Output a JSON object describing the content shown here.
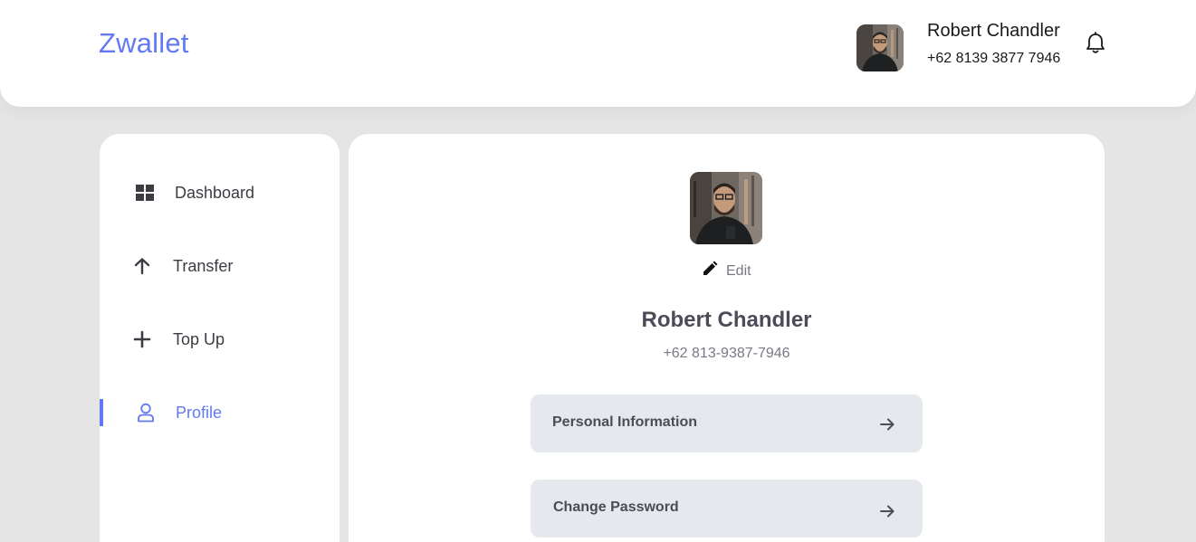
{
  "brand": "Zwallet",
  "user": {
    "name": "Robert Chandler",
    "header_phone": "+62 8139 3877 7946",
    "profile_phone": "+62 813-9387-7946"
  },
  "icons": {
    "bell": "bell-icon",
    "dashboard": "grid-icon",
    "transfer": "arrow-up-icon",
    "topup": "plus-icon",
    "profile": "user-icon",
    "edit": "pencil-icon",
    "arrow": "arrow-right-icon"
  },
  "sidebar": {
    "items": [
      {
        "label": "Dashboard",
        "active": false
      },
      {
        "label": "Transfer",
        "active": false
      },
      {
        "label": "Top Up",
        "active": false
      },
      {
        "label": "Profile",
        "active": true
      }
    ]
  },
  "profile": {
    "edit_label": "Edit",
    "menu": [
      {
        "label": "Personal Information"
      },
      {
        "label": "Change Password"
      }
    ]
  },
  "colors": {
    "accent": "#6379f4",
    "background": "#e5e5e5",
    "card": "#ffffff",
    "menu_button": "#e5e8ed",
    "text_dark": "#4d4b57",
    "text_muted": "#7a7886"
  }
}
